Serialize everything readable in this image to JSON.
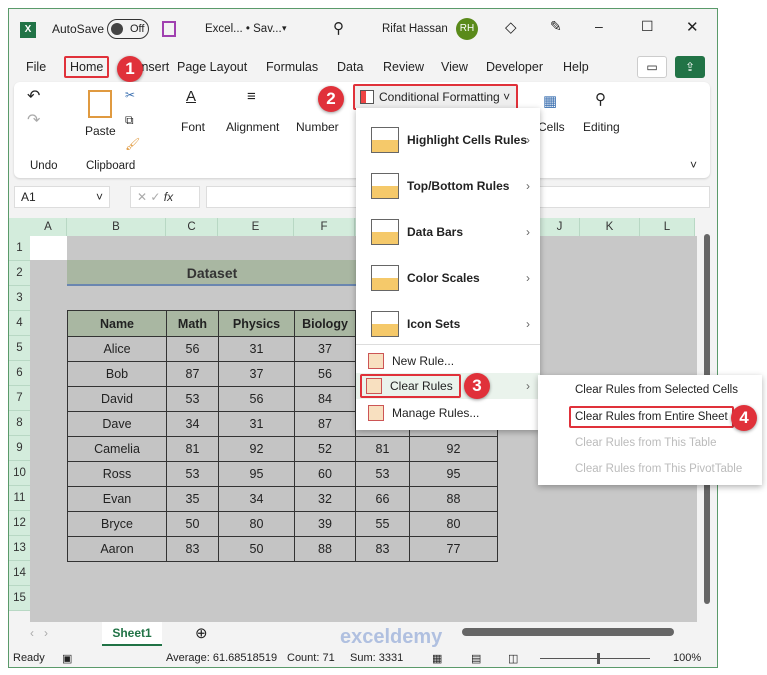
{
  "titlebar": {
    "autosave": "AutoSave",
    "toggle": "Off",
    "filename": "Excel... • Sav...",
    "user": "Rifat Hassan",
    "initials": "RH"
  },
  "tabs": [
    "File",
    "Home",
    "Insert",
    "Page Layout",
    "Formulas",
    "Data",
    "Review",
    "View",
    "Developer",
    "Help"
  ],
  "ribbon": {
    "undo": "Undo",
    "paste": "Paste",
    "clipboard": "Clipboard",
    "font": "Font",
    "alignment": "Alignment",
    "number": "Number",
    "cf": "Conditional Formatting",
    "cells": "Cells",
    "editing": "Editing"
  },
  "formula_bar": {
    "namebox": "A1",
    "fx": "fx",
    "value": ""
  },
  "columns": [
    "A",
    "B",
    "C",
    "E",
    "F",
    "",
    "",
    "",
    "J",
    "K",
    "L"
  ],
  "rows": [
    "1",
    "2",
    "3",
    "4",
    "5",
    "6",
    "7",
    "8",
    "9",
    "10",
    "11",
    "12",
    "13",
    "14",
    "15"
  ],
  "dataset_title": "Dataset",
  "table": {
    "headers": [
      "Name",
      "Math",
      "Physics",
      "Biology",
      "",
      ""
    ],
    "rows": [
      [
        "Alice",
        "56",
        "31",
        "37",
        "",
        ""
      ],
      [
        "Bob",
        "87",
        "37",
        "56",
        "",
        ""
      ],
      [
        "David",
        "53",
        "56",
        "84",
        "",
        ""
      ],
      [
        "Dave",
        "34",
        "31",
        "87",
        "",
        ""
      ],
      [
        "Camelia",
        "81",
        "92",
        "52",
        "81",
        "92"
      ],
      [
        "Ross",
        "53",
        "95",
        "60",
        "53",
        "95"
      ],
      [
        "Evan",
        "35",
        "34",
        "32",
        "66",
        "88"
      ],
      [
        "Bryce",
        "50",
        "80",
        "39",
        "55",
        "80"
      ],
      [
        "Aaron",
        "83",
        "50",
        "88",
        "83",
        "77"
      ]
    ]
  },
  "menu": {
    "items": [
      "Highlight Cells Rules",
      "Top/Bottom Rules",
      "Data Bars",
      "Color Scales",
      "Icon Sets"
    ],
    "new_rule": "New Rule...",
    "clear_rules": "Clear Rules",
    "manage_rules": "Manage Rules..."
  },
  "submenu": [
    "Clear Rules from Selected Cells",
    "Clear Rules from Entire Sheet",
    "Clear Rules from This Table",
    "Clear Rules from This PivotTable"
  ],
  "badges": [
    "1",
    "2",
    "3",
    "4"
  ],
  "sheet_tab": "Sheet1",
  "status": {
    "ready": "Ready",
    "average": "Average: 61.68518519",
    "count": "Count: 71",
    "sum": "Sum: 3331",
    "zoom": "100%"
  },
  "watermark": "exceldemy",
  "colors": {
    "excel_green": "#217346",
    "highlight_red": "#e0313a",
    "header_fill": "#a9b7a2"
  }
}
